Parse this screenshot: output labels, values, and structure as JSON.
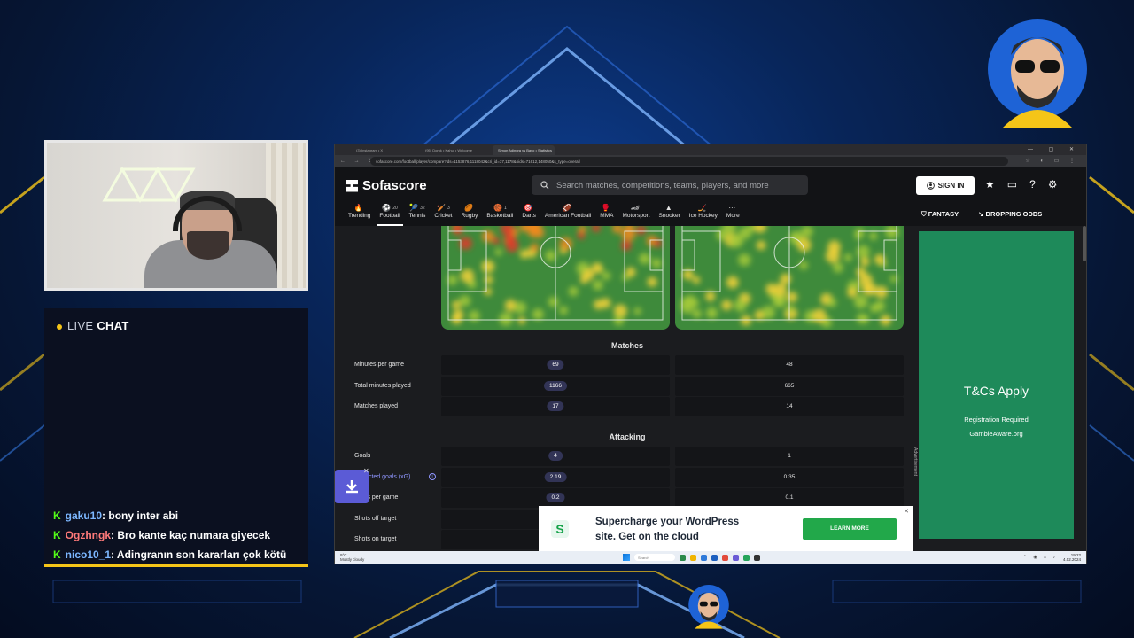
{
  "chat": {
    "live": "LIVE",
    "title": "CHAT",
    "messages": [
      {
        "user": "gaku10",
        "color": "#7cb7ff",
        "text": ": bony inter abi"
      },
      {
        "user": "Ogzhngk",
        "color": "#ff7a7a",
        "text": ": Bro kante kaç numara giyecek"
      },
      {
        "user": "nico10_1",
        "color": "#7cb7ff",
        "text": ": Adingranın son kararları çok kötü"
      }
    ]
  },
  "browser": {
    "tabs": [
      "(3) Instagram • X",
      "(95) Doruk • Kahul • Welcome",
      "Simon Adingra vs Bayo • Statistics"
    ],
    "url": "sofascore.com/football/player/compare?ids=1153876,1118042&cri_id=37,1178&pids=71612,148050&s_type=overall"
  },
  "site": {
    "logo": "Sofascore",
    "search_placeholder": "Search matches, competitions, teams, players, and more",
    "signin": "SIGN IN",
    "nav": [
      {
        "label": "Trending",
        "icon": "🔥",
        "count": "",
        "active": false
      },
      {
        "label": "Football",
        "icon": "⚽",
        "count": "20",
        "active": true
      },
      {
        "label": "Tennis",
        "icon": "🎾",
        "count": "32",
        "active": false
      },
      {
        "label": "Cricket",
        "icon": "🏏",
        "count": "3",
        "active": false
      },
      {
        "label": "Rugby",
        "icon": "🏉",
        "count": "",
        "active": false
      },
      {
        "label": "Basketball",
        "icon": "🏀",
        "count": "1",
        "active": false
      },
      {
        "label": "Darts",
        "icon": "🎯",
        "count": "",
        "active": false
      },
      {
        "label": "American Football",
        "icon": "🏈",
        "count": "",
        "active": false
      },
      {
        "label": "MMA",
        "icon": "🥊",
        "count": "",
        "active": false
      },
      {
        "label": "Motorsport",
        "icon": "🏎",
        "count": "",
        "active": false
      },
      {
        "label": "Snooker",
        "icon": "▲",
        "count": "",
        "active": false
      },
      {
        "label": "Ice Hockey",
        "icon": "🏒",
        "count": "",
        "active": false
      },
      {
        "label": "More",
        "icon": "···",
        "count": "",
        "active": false
      }
    ],
    "fantasy": "FANTASY",
    "dropping_odds": "DROPPING ODDS"
  },
  "stats": {
    "matches_title": "Matches",
    "matches": [
      {
        "label": "Minutes per game",
        "a": "69",
        "b": "48"
      },
      {
        "label": "Total minutes played",
        "a": "1166",
        "b": "665"
      },
      {
        "label": "Matches played",
        "a": "17",
        "b": "14"
      }
    ],
    "attacking_title": "Attacking",
    "attacking": [
      {
        "label": "Goals",
        "a": "4",
        "b": "1"
      },
      {
        "label": "Expected goals (xG)",
        "a": "2.19",
        "b": "0.35"
      },
      {
        "label": "Shots per game",
        "a": "0.2",
        "b": "0.1"
      },
      {
        "label": "Shots off target",
        "a": "",
        "b": ""
      },
      {
        "label": "Shots on target",
        "a": "",
        "b": ""
      }
    ]
  },
  "ad": {
    "title": "T&Cs Apply",
    "line1": "Registration Required",
    "line2": "GambleAware.org",
    "side": "Advertisement"
  },
  "banner": {
    "line1": "Supercharge your WordPress",
    "line2": "site. Get on the cloud",
    "cta": "LEARN MORE"
  },
  "taskbar": {
    "weather_temp": "9°C",
    "weather_desc": "Mostly cloudy",
    "search": "Search",
    "time": "19:22",
    "date": "4.02.2024"
  }
}
